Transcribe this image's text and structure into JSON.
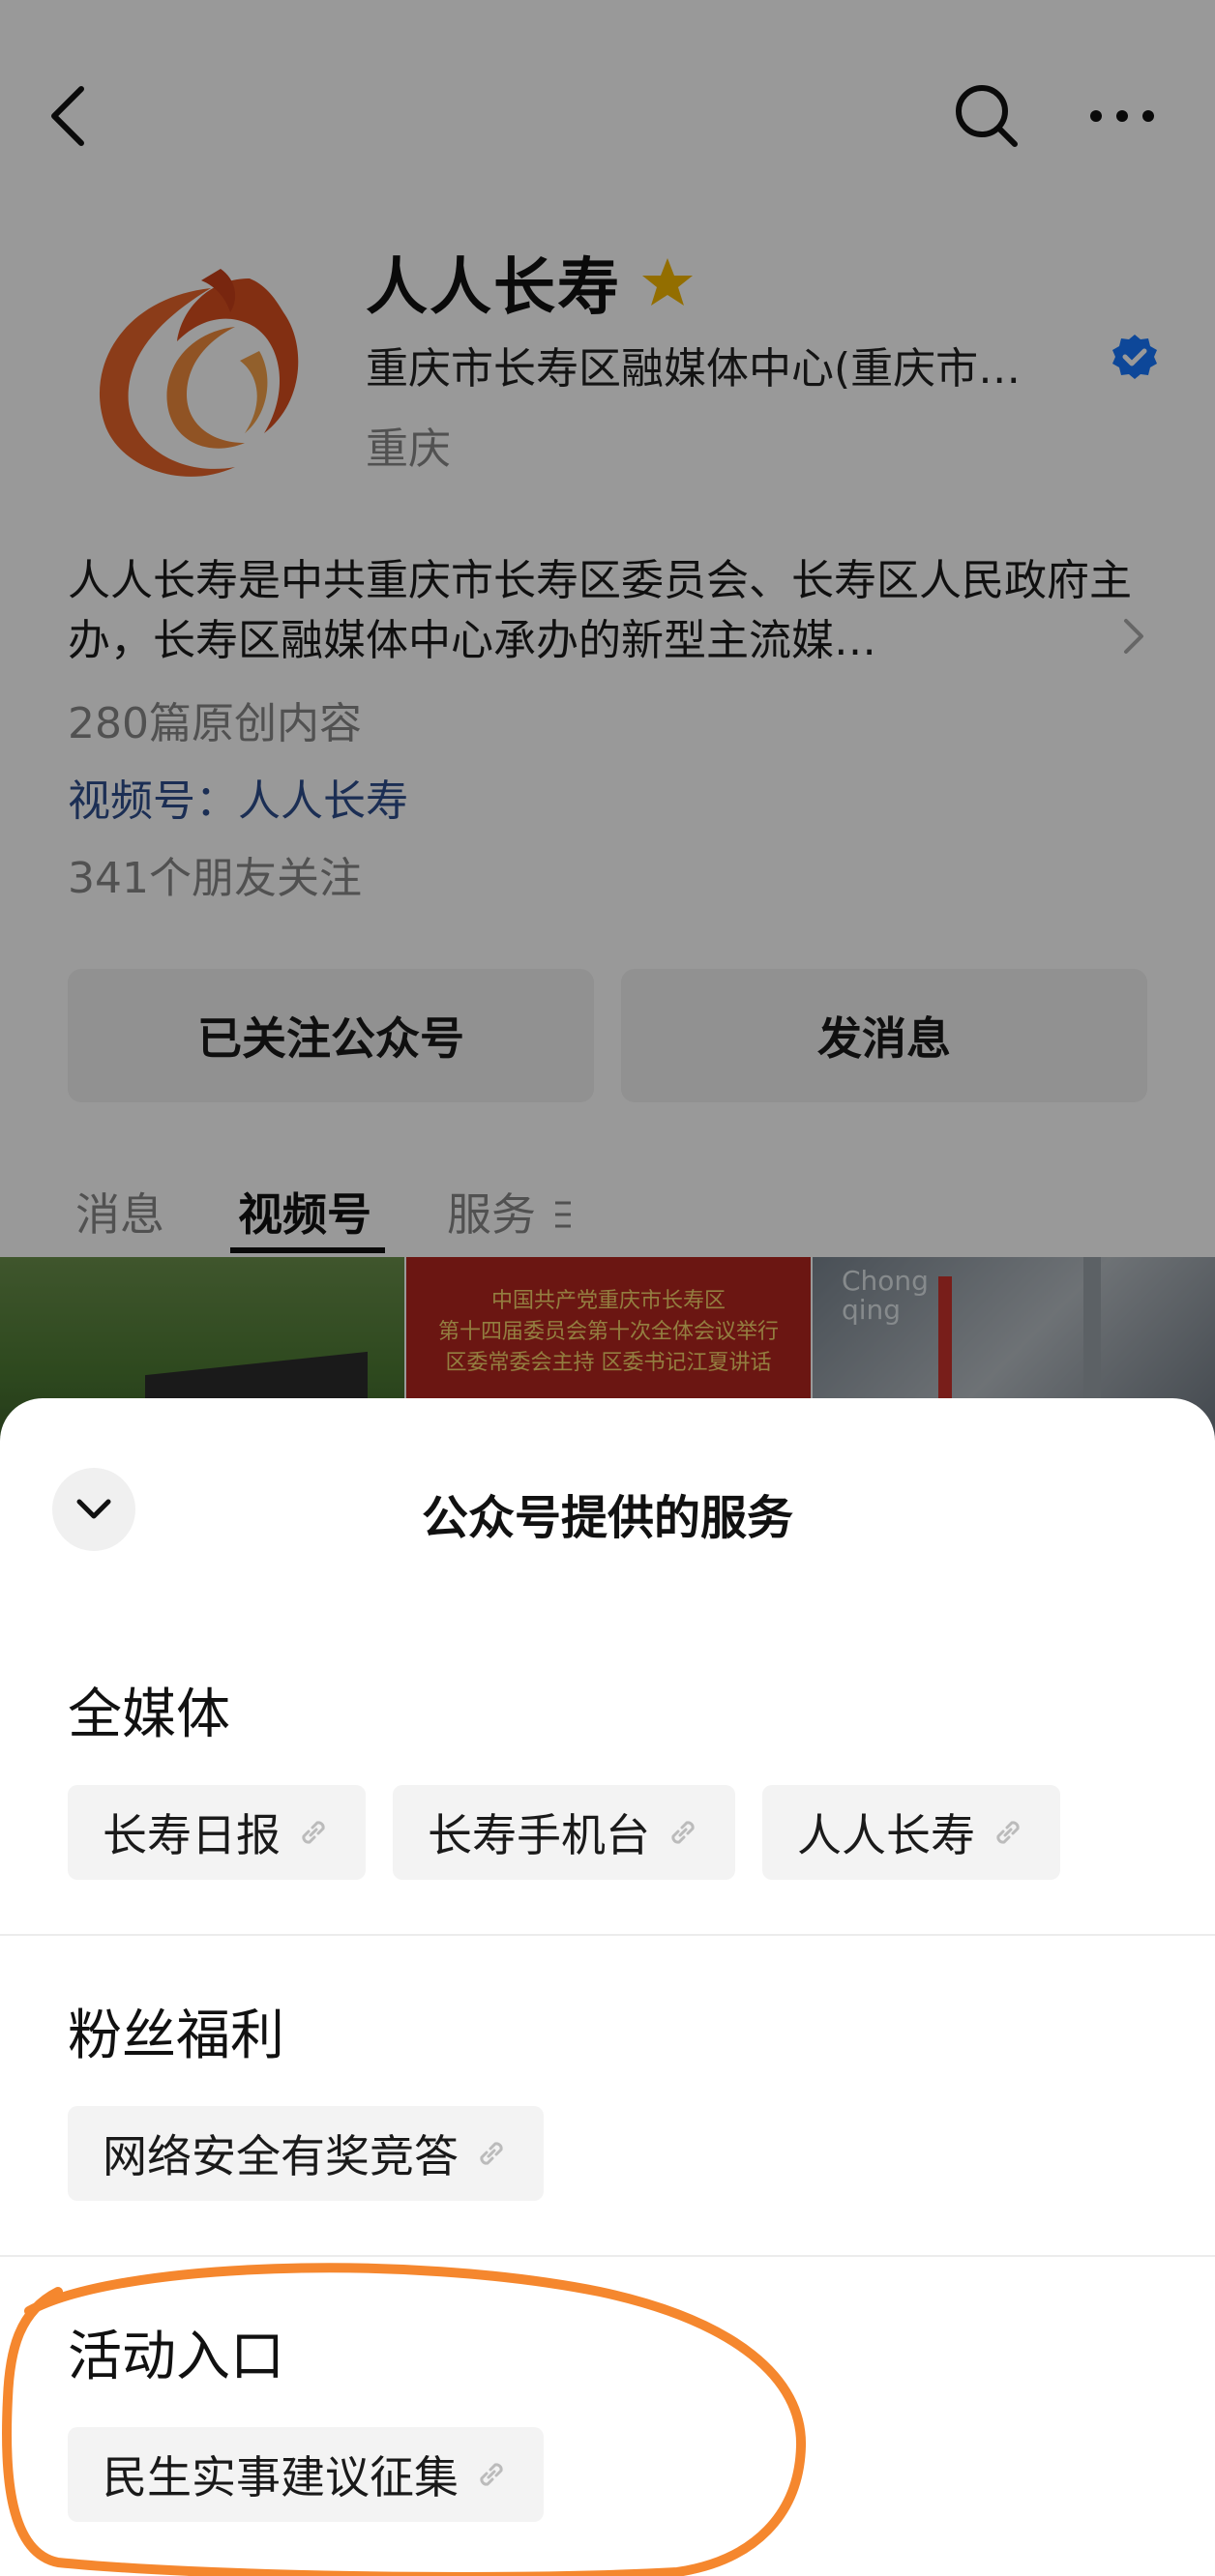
{
  "colors": {
    "overlay": "rgba(0,0,0,0.40)",
    "channel_link": "#2d4d8c",
    "verified": "#1677ff",
    "star": "#f5b800",
    "highlight_circle": "#f5872e"
  },
  "profile": {
    "name": "人人长寿",
    "organization": "重庆市长寿区融媒体中心(重庆市…",
    "region": "重庆",
    "description": "人人长寿是中共重庆市长寿区委员会、长寿区人民政府主办，长寿区融媒体中心承办的新型主流媒…",
    "original_count": "280篇原创内容",
    "channel": "视频号：人人长寿",
    "friends_following": "341个朋友关注",
    "follow_button": "已关注公众号",
    "message_button": "发消息"
  },
  "tabs": [
    {
      "label": "消息",
      "active": false
    },
    {
      "label": "视频号",
      "active": true
    },
    {
      "label": "服务",
      "active": false
    }
  ],
  "thumbnails": {
    "thumb2_lines": [
      "中国共产党重庆市长寿区",
      "第十四届委员会第十次全体会议举行",
      "区委常委会主持 区委书记江夏讲话"
    ],
    "thumb3_sign": "Chong\nqing"
  },
  "sheet": {
    "title": "公众号提供的服务",
    "sections": [
      {
        "title": "全媒体",
        "items": [
          "长寿日报",
          "长寿手机台",
          "人人长寿"
        ]
      },
      {
        "title": "粉丝福利",
        "items": [
          "网络安全有奖竞答"
        ]
      },
      {
        "title": "活动入口",
        "items": [
          "民生实事建议征集"
        ]
      }
    ]
  }
}
